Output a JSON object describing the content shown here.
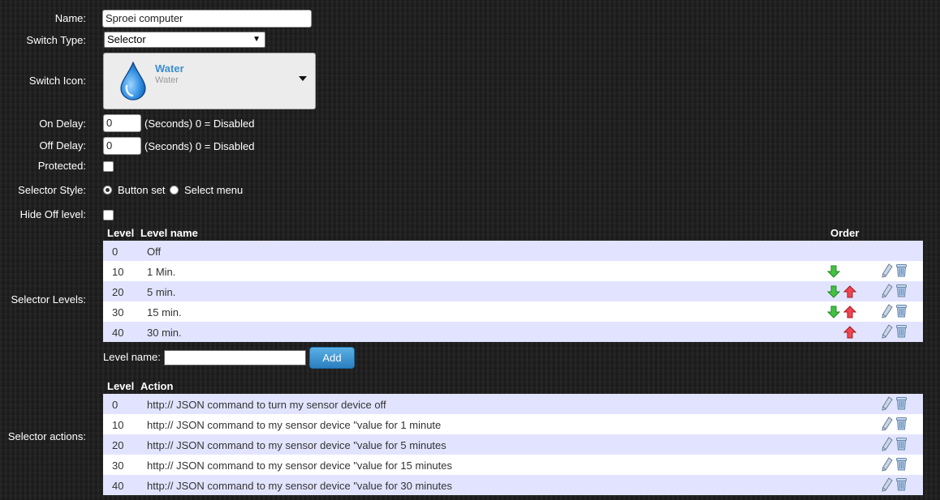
{
  "labels": {
    "name": "Name:",
    "switch_type": "Switch Type:",
    "switch_icon": "Switch Icon:",
    "on_delay": "On Delay:",
    "off_delay": "Off Delay:",
    "protected": "Protected:",
    "selector_style": "Selector Style:",
    "hide_off_level": "Hide Off level:",
    "selector_levels": "Selector Levels:",
    "selector_actions": "Selector actions:"
  },
  "name_value": "Sproei computer",
  "switch_type_value": "Selector",
  "icon": {
    "title": "Water",
    "subtitle": "Water",
    "color_title": "#3a8fd0"
  },
  "on_delay": {
    "value": "0",
    "hint": "(Seconds) 0 = Disabled"
  },
  "off_delay": {
    "value": "0",
    "hint": "(Seconds) 0 = Disabled"
  },
  "protected_checked": false,
  "hide_off_checked": false,
  "selector_style": {
    "option_button_set": "Button set",
    "option_select_menu": "Select menu",
    "selected": "Button set"
  },
  "levels_table": {
    "headers": {
      "level": "Level",
      "level_name": "Level name",
      "order": "Order"
    },
    "rows": [
      {
        "level": "0",
        "name": "Off"
      },
      {
        "level": "10",
        "name": "1 Min."
      },
      {
        "level": "20",
        "name": "5 min."
      },
      {
        "level": "30",
        "name": "15 min."
      },
      {
        "level": "40",
        "name": "30 min."
      }
    ]
  },
  "level_name_input": {
    "label": "Level name:",
    "value": ""
  },
  "add_button": "Add",
  "actions_table": {
    "headers": {
      "level": "Level",
      "action": "Action"
    },
    "rows": [
      {
        "level": "0",
        "action": "http:// JSON command to turn my sensor device off"
      },
      {
        "level": "10",
        "action": "http:// JSON command to my sensor device \"value for 1 minute"
      },
      {
        "level": "20",
        "action": "http:// JSON command to my sensor device \"value for 5 minutes"
      },
      {
        "level": "30",
        "action": "http:// JSON command to my sensor device \"value for 15 minutes"
      },
      {
        "level": "40",
        "action": "http:// JSON command to my sensor device \"value for 30 minutes"
      }
    ]
  },
  "icons": {
    "down": "arrow-down-icon",
    "up": "arrow-up-icon",
    "edit": "pencil-icon",
    "delete": "trash-icon",
    "water": "water-drop-icon"
  },
  "colors": {
    "row_odd": "#e2e4ff",
    "row_even": "#ffffff",
    "down_arrow": "#3cb83c",
    "up_arrow": "#e0313b",
    "add_button": "#3a8fd0"
  }
}
